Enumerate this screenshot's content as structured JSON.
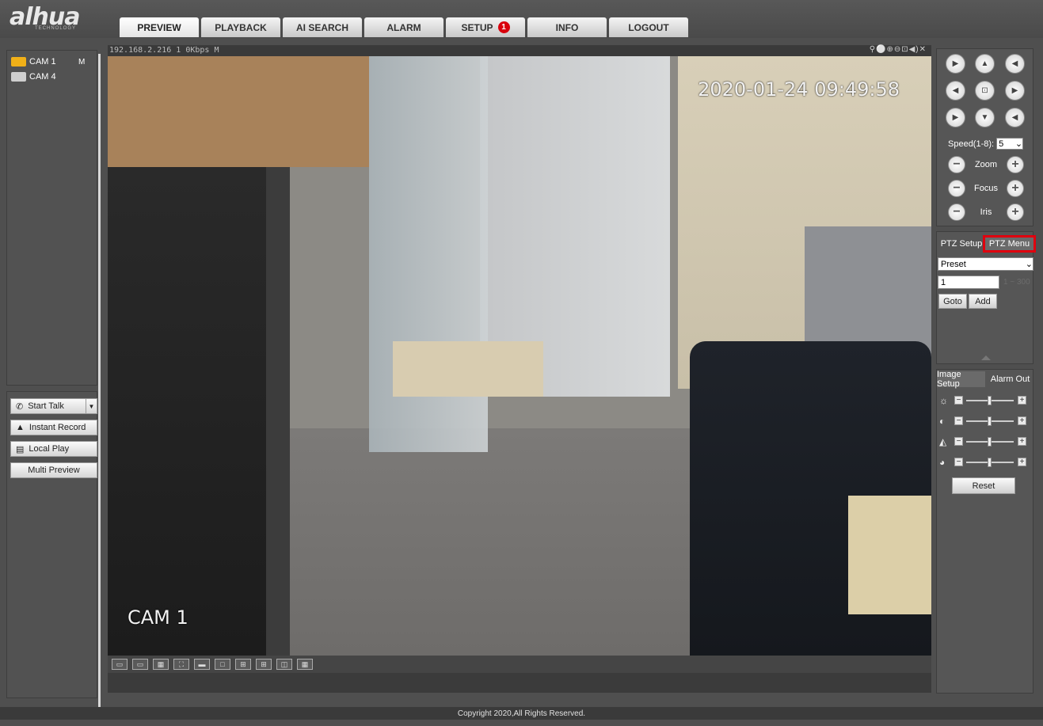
{
  "header": {
    "logo": "alhua",
    "logo_sub": "TECHNOLOGY",
    "tabs": [
      {
        "label": "PREVIEW",
        "active": true
      },
      {
        "label": "PLAYBACK"
      },
      {
        "label": "AI SEARCH"
      },
      {
        "label": "ALARM"
      },
      {
        "label": "SETUP",
        "badge": "1"
      },
      {
        "label": "INFO"
      },
      {
        "label": "LOGOUT"
      }
    ]
  },
  "cameras": [
    {
      "label": "CAM 1",
      "stream": "M",
      "icon": "camera-active-icon"
    },
    {
      "label": "CAM 4",
      "icon": "camera-icon"
    }
  ],
  "controls": {
    "start_talk": "Start Talk",
    "instant_record": "Instant Record",
    "local_play": "Local Play",
    "multi_preview": "Multi Preview"
  },
  "video": {
    "info": "192.168.2.216 1 0Kbps M",
    "tools": "⚲⚪⊕⊖⊡◀)✕",
    "timestamp": "2020-01-24 09:49:58",
    "cam_label": "CAM 1"
  },
  "ptz": {
    "speed_label": "Speed(1-8):",
    "speed_value": "5",
    "zoom": "Zoom",
    "focus": "Focus",
    "iris": "Iris"
  },
  "preset": {
    "tab_setup": "PTZ Setup",
    "tab_menu": "PTZ Menu",
    "mode": "Preset",
    "value": "1",
    "range": "1 ~ 300",
    "goto": "Goto",
    "add": "Add"
  },
  "image": {
    "tab_setup": "Image Setup",
    "tab_alarm": "Alarm Out",
    "reset": "Reset",
    "sliders": [
      {
        "icon": "brightness-icon",
        "level": 0.5
      },
      {
        "icon": "contrast-icon",
        "level": 0.5
      },
      {
        "icon": "saturation-icon",
        "level": 0.5
      },
      {
        "icon": "hue-icon",
        "level": 0.5
      }
    ]
  },
  "footer": {
    "copyright": "Copyright 2020,All Rights Reserved."
  }
}
